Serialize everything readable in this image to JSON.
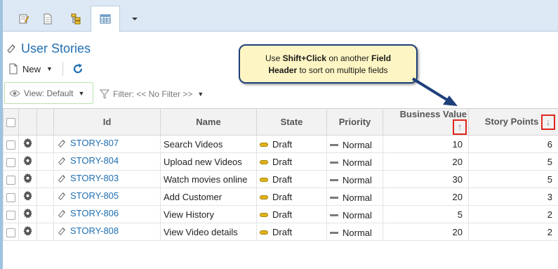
{
  "colors": {
    "accent": "#1f6fb2",
    "draft": "#e0b31a",
    "sort_highlight": "#e0261c",
    "callout_bg": "#fdf5c3",
    "callout_border": "#1d3f7a"
  },
  "tabs": [
    {
      "icon": "edit-doc-icon"
    },
    {
      "icon": "document-icon"
    },
    {
      "icon": "hierarchy-icon"
    },
    {
      "icon": "grid-icon",
      "active": true
    },
    {
      "icon": "chevron-down-icon"
    }
  ],
  "page": {
    "title": "User Stories"
  },
  "toolbar": {
    "new_label": "New"
  },
  "view": {
    "label": "View: Default"
  },
  "filter": {
    "label": "Filter: << No Filter >>"
  },
  "callout": {
    "line1_prefix": "Use ",
    "line1_bold": "Shift+Click",
    "line1_mid": " on another ",
    "line1_bold2": "Field",
    "line2_bold": "Header",
    "line2_suffix": " to sort on multiple fields"
  },
  "grid": {
    "columns": {
      "id": "Id",
      "name": "Name",
      "state": "State",
      "priority": "Priority",
      "business_value": "Business Value",
      "story_points": "Story Points"
    },
    "sort": {
      "business_value": "↑",
      "story_points": "↓"
    },
    "rows": [
      {
        "id": "STORY-807",
        "name": "Search Videos",
        "state": "Draft",
        "priority": "Normal",
        "business_value": "10",
        "story_points": "6"
      },
      {
        "id": "STORY-804",
        "name": "Upload new Videos",
        "state": "Draft",
        "priority": "Normal",
        "business_value": "20",
        "story_points": "5"
      },
      {
        "id": "STORY-803",
        "name": "Watch movies online",
        "state": "Draft",
        "priority": "Normal",
        "business_value": "30",
        "story_points": "5"
      },
      {
        "id": "STORY-805",
        "name": "Add Customer",
        "state": "Draft",
        "priority": "Normal",
        "business_value": "20",
        "story_points": "3"
      },
      {
        "id": "STORY-806",
        "name": "View History",
        "state": "Draft",
        "priority": "Normal",
        "business_value": "5",
        "story_points": "2"
      },
      {
        "id": "STORY-808",
        "name": "View Video details",
        "state": "Draft",
        "priority": "Normal",
        "business_value": "20",
        "story_points": "2"
      }
    ]
  }
}
